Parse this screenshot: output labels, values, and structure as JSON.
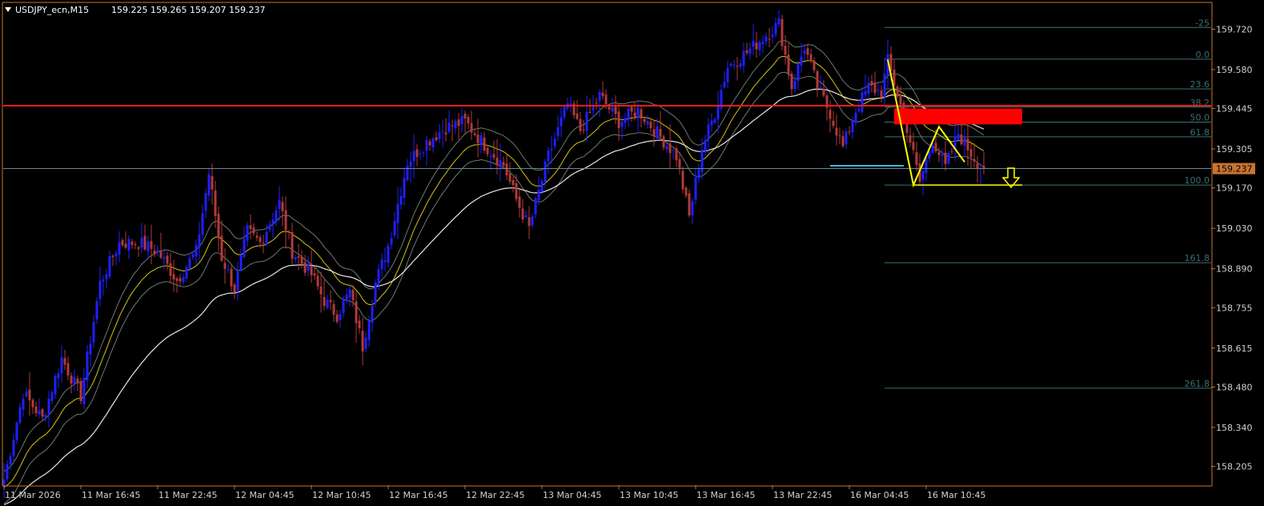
{
  "header": {
    "symbol": "USDJPY_ecn,M15",
    "ohlc": "159.225 159.265 159.207 159.237"
  },
  "colors": {
    "background": "#000000",
    "bull": "#1f1fff",
    "bear": "#b23a3a",
    "ma_fast": "#d4c414",
    "ma_band": "#6c7a6e",
    "ma_slow": "#e8e8e8",
    "resistance": "#ff1a1a",
    "current_price_line": "#6d8a96",
    "fib": "#3d7276",
    "zone": "#ff0000",
    "pattern": "#ffff00",
    "price_tag_bg": "#c8742e",
    "axis": "#c8742e"
  },
  "chart_data": {
    "type": "candlestick",
    "ylim": [
      158.14,
      159.81
    ],
    "y_ticks": [
      159.72,
      159.58,
      159.445,
      159.305,
      159.17,
      159.03,
      158.89,
      158.755,
      158.615,
      158.48,
      158.34,
      158.205
    ],
    "y_tick_labels": [
      "159.720",
      "159.580",
      "159.445",
      "159.305",
      "159.170",
      "159.030",
      "158.890",
      "158.755",
      "158.615",
      "158.480",
      "158.340",
      "158.205"
    ],
    "x_tick_labels": [
      "11 Mar 2026",
      "11 Mar 16:45",
      "11 Mar 22:45",
      "12 Mar 04:45",
      "12 Mar 10:45",
      "12 Mar 16:45",
      "12 Mar 22:45",
      "13 Mar 04:45",
      "13 Mar 10:45",
      "13 Mar 16:45",
      "13 Mar 22:45",
      "16 Mar 04:45",
      "16 Mar 10:45"
    ],
    "x_tick_bar_index": [
      0,
      24,
      48,
      72,
      96,
      120,
      144,
      168,
      192,
      216,
      240,
      264,
      288
    ],
    "current_price": 159.237,
    "current_price_label": "159.237",
    "resistance_level": 159.455,
    "close_path": [
      [
        0,
        158.16
      ],
      [
        6,
        158.46
      ],
      [
        12,
        158.37
      ],
      [
        18,
        158.58
      ],
      [
        24,
        158.45
      ],
      [
        30,
        158.84
      ],
      [
        36,
        158.98
      ],
      [
        42,
        158.98
      ],
      [
        48,
        158.95
      ],
      [
        54,
        158.85
      ],
      [
        60,
        158.95
      ],
      [
        64,
        159.22
      ],
      [
        68,
        158.93
      ],
      [
        72,
        158.82
      ],
      [
        76,
        159.02
      ],
      [
        80,
        158.98
      ],
      [
        86,
        159.12
      ],
      [
        90,
        158.95
      ],
      [
        96,
        158.87
      ],
      [
        100,
        158.78
      ],
      [
        104,
        158.73
      ],
      [
        108,
        158.81
      ],
      [
        112,
        158.62
      ],
      [
        116,
        158.84
      ],
      [
        120,
        158.97
      ],
      [
        126,
        159.26
      ],
      [
        132,
        159.33
      ],
      [
        138,
        159.38
      ],
      [
        144,
        159.4
      ],
      [
        150,
        159.32
      ],
      [
        156,
        159.25
      ],
      [
        160,
        159.13
      ],
      [
        164,
        159.03
      ],
      [
        170,
        159.28
      ],
      [
        176,
        159.46
      ],
      [
        180,
        159.37
      ],
      [
        186,
        159.49
      ],
      [
        192,
        159.4
      ],
      [
        198,
        159.44
      ],
      [
        204,
        159.36
      ],
      [
        210,
        159.28
      ],
      [
        214,
        159.07
      ],
      [
        218,
        159.31
      ],
      [
        222,
        159.43
      ],
      [
        226,
        159.59
      ],
      [
        232,
        159.64
      ],
      [
        238,
        159.7
      ],
      [
        242,
        159.74
      ],
      [
        246,
        159.52
      ],
      [
        250,
        159.66
      ],
      [
        254,
        159.52
      ],
      [
        258,
        159.43
      ],
      [
        262,
        159.31
      ],
      [
        266,
        159.44
      ],
      [
        270,
        159.52
      ],
      [
        274,
        159.5
      ],
      [
        276,
        159.61
      ],
      [
        282,
        159.38
      ],
      [
        286,
        159.19
      ],
      [
        290,
        159.34
      ],
      [
        294,
        159.24
      ],
      [
        298,
        159.36
      ],
      [
        302,
        159.29
      ],
      [
        306,
        159.23
      ]
    ],
    "fibonacci": {
      "levels": [
        {
          "label": "-25",
          "price": 159.726
        },
        {
          "label": "0.0",
          "price": 159.616
        },
        {
          "label": "23.6",
          "price": 159.513
        },
        {
          "label": "38.2",
          "price": 159.45
        },
        {
          "label": "50.0",
          "price": 159.398
        },
        {
          "label": "61.8",
          "price": 159.347
        },
        {
          "label": "100.0",
          "price": 159.18
        },
        {
          "label": "161.8",
          "price": 158.911
        },
        {
          "label": "261.8",
          "price": 158.476
        }
      ]
    },
    "zone": {
      "price_high": 159.445,
      "price_low": 159.39
    },
    "support_line_price": 159.247,
    "pattern_points": [
      [
        276,
        159.615
      ],
      [
        284,
        159.18
      ],
      [
        292,
        159.382
      ],
      [
        300,
        159.26
      ]
    ],
    "pattern_base_price": 159.18
  }
}
